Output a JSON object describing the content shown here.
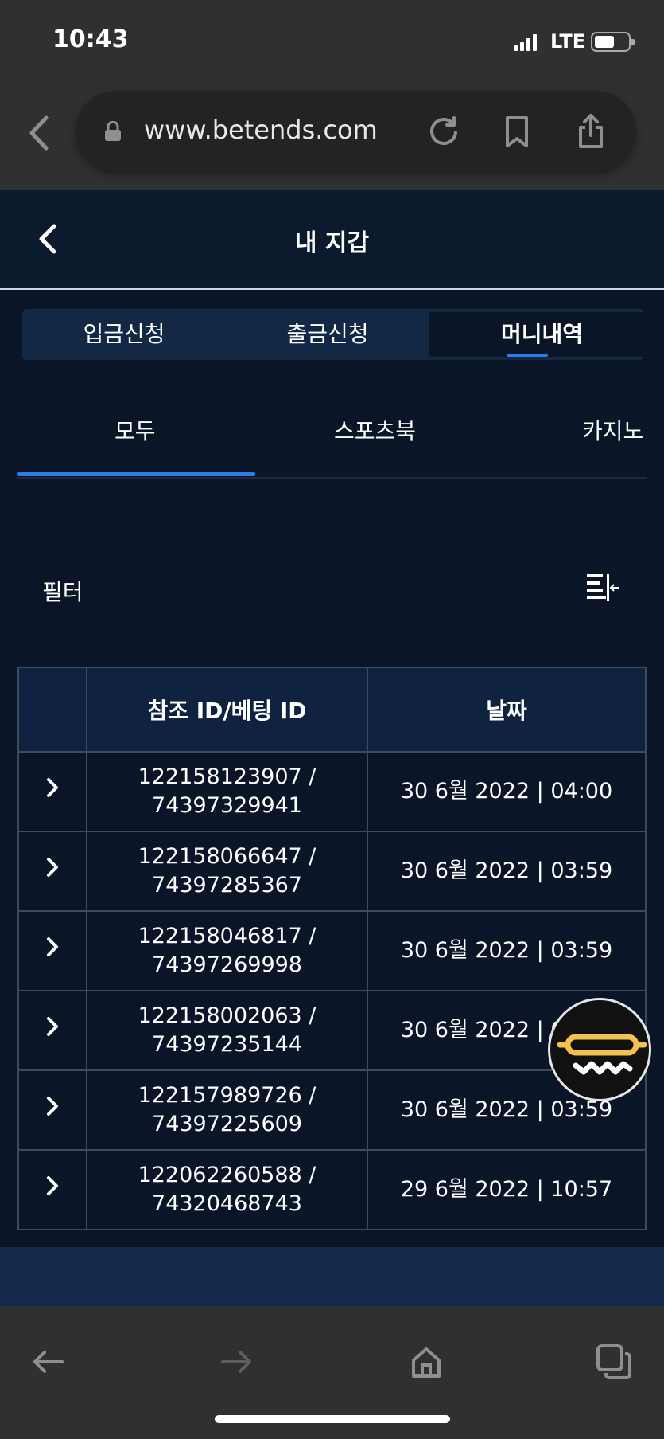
{
  "status_bar": {
    "time": "10:43",
    "network": "LTE"
  },
  "browser": {
    "url": "www.betends.com"
  },
  "header": {
    "title": "내 지갑"
  },
  "segment_tabs": [
    {
      "label": "입금신청",
      "active": false
    },
    {
      "label": "출금신청",
      "active": false
    },
    {
      "label": "머니내역",
      "active": true
    }
  ],
  "sub_tabs": [
    {
      "label": "모두",
      "active": true
    },
    {
      "label": "스포츠북",
      "active": false
    },
    {
      "label": "카지노",
      "active": false
    }
  ],
  "filter": {
    "label": "필터"
  },
  "table": {
    "headers": [
      "",
      "참조 ID/베팅 ID",
      "날짜"
    ],
    "rows": [
      {
        "ref_line1": "122158123907 /",
        "ref_line2": "74397329941",
        "date": "30 6월 2022 | 04:00"
      },
      {
        "ref_line1": "122158066647 /",
        "ref_line2": "74397285367",
        "date": "30 6월 2022 | 03:59"
      },
      {
        "ref_line1": "122158046817 /",
        "ref_line2": "74397269998",
        "date": "30 6월 2022 | 03:59"
      },
      {
        "ref_line1": "122158002063 /",
        "ref_line2": "74397235144",
        "date": "30 6월 2022 | 03:59"
      },
      {
        "ref_line1": "122157989726 /",
        "ref_line2": "74397225609",
        "date": "30 6월 2022 | 03:59"
      },
      {
        "ref_line1": "122062260588 /",
        "ref_line2": "74320468743",
        "date": "29 6월 2022 | 10:57"
      }
    ]
  },
  "colors": {
    "accent": "#2f7be6",
    "background": "#0a1628",
    "fab_accent": "#f2c14e"
  }
}
